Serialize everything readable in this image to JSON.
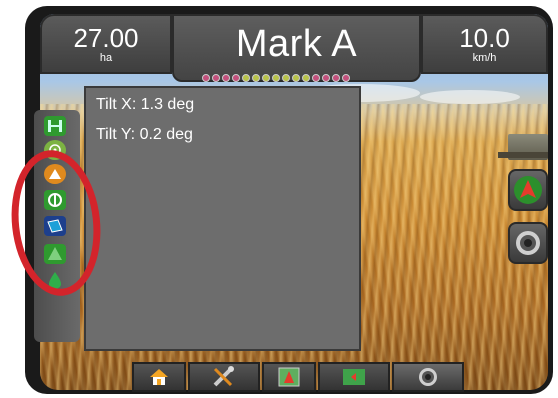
{
  "header": {
    "area_value": "27.00",
    "area_unit": "ha",
    "title": "Mark A",
    "speed_value": "10.0",
    "speed_unit": "km/h"
  },
  "boom_dots": [
    "#c2507c",
    "#c2507c",
    "#c2507c",
    "#c2507c",
    "#b8c24a",
    "#b8c24a",
    "#b8c24a",
    "#b8c24a",
    "#b8c24a",
    "#b8c24a",
    "#b8c24a",
    "#c2507c",
    "#c2507c",
    "#c2507c",
    "#c2507c"
  ],
  "panel": {
    "tilt_x": "Tilt X: 1.3 deg",
    "tilt_y": "Tilt Y: 0.2 deg"
  },
  "sidebar": {
    "icons": [
      "status-icon",
      "gps-icon",
      "alert-icon",
      "steering-icon",
      "tilt-sensor-icon",
      "boom-icon",
      "flow-icon"
    ]
  },
  "right_buttons": [
    "guidance-arrow-icon",
    "camera-icon"
  ],
  "bottom_nav": [
    "home-icon",
    "tools-icon",
    "vehicle-view-icon",
    "field-view-icon",
    "camera-icon"
  ],
  "colors": {
    "highlight_ring": "#d3242b",
    "accent_green": "#2f9a2f"
  }
}
